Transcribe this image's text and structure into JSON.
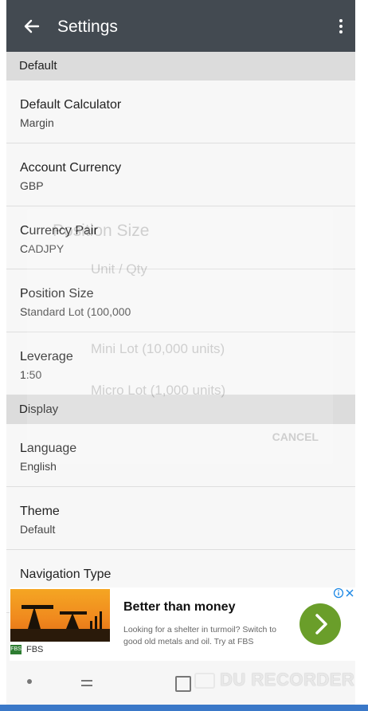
{
  "appbar": {
    "title": "Settings",
    "back_icon": "arrow-left-icon",
    "more_icon": "more-vert-icon"
  },
  "sections": [
    {
      "header": "Default",
      "items": [
        {
          "title": "Default Calculator",
          "value": "Margin"
        },
        {
          "title": "Account Currency",
          "value": "GBP"
        },
        {
          "title": "Currency Pair",
          "value": "CADJPY"
        },
        {
          "title": "Position Size",
          "value": "Standard Lot (100,000"
        },
        {
          "title": "Leverage",
          "value": "1:50"
        }
      ]
    },
    {
      "header": "Display",
      "items": [
        {
          "title": "Language",
          "value": "English"
        },
        {
          "title": "Theme",
          "value": "Default"
        },
        {
          "title": "Navigation Type",
          "value": ""
        }
      ]
    }
  ],
  "ghost_dialog": {
    "title": "Position Size",
    "options": [
      "Unit / Qty",
      "Mini Lot (10,000 units)",
      "Micro Lot (1,000 units)"
    ],
    "cancel": "CANCEL"
  },
  "ad": {
    "headline": "Better than money",
    "body": "Looking for a shelter in turmoil? Switch to good old metals and oil. Try at FBS",
    "brand": "FBS",
    "button_color": "#6a9e2a"
  },
  "watermark": "DU RECORDER",
  "colors": {
    "appbar": "#434a51",
    "section": "#dcdcdc",
    "accent_bar": "#3a78c8"
  }
}
